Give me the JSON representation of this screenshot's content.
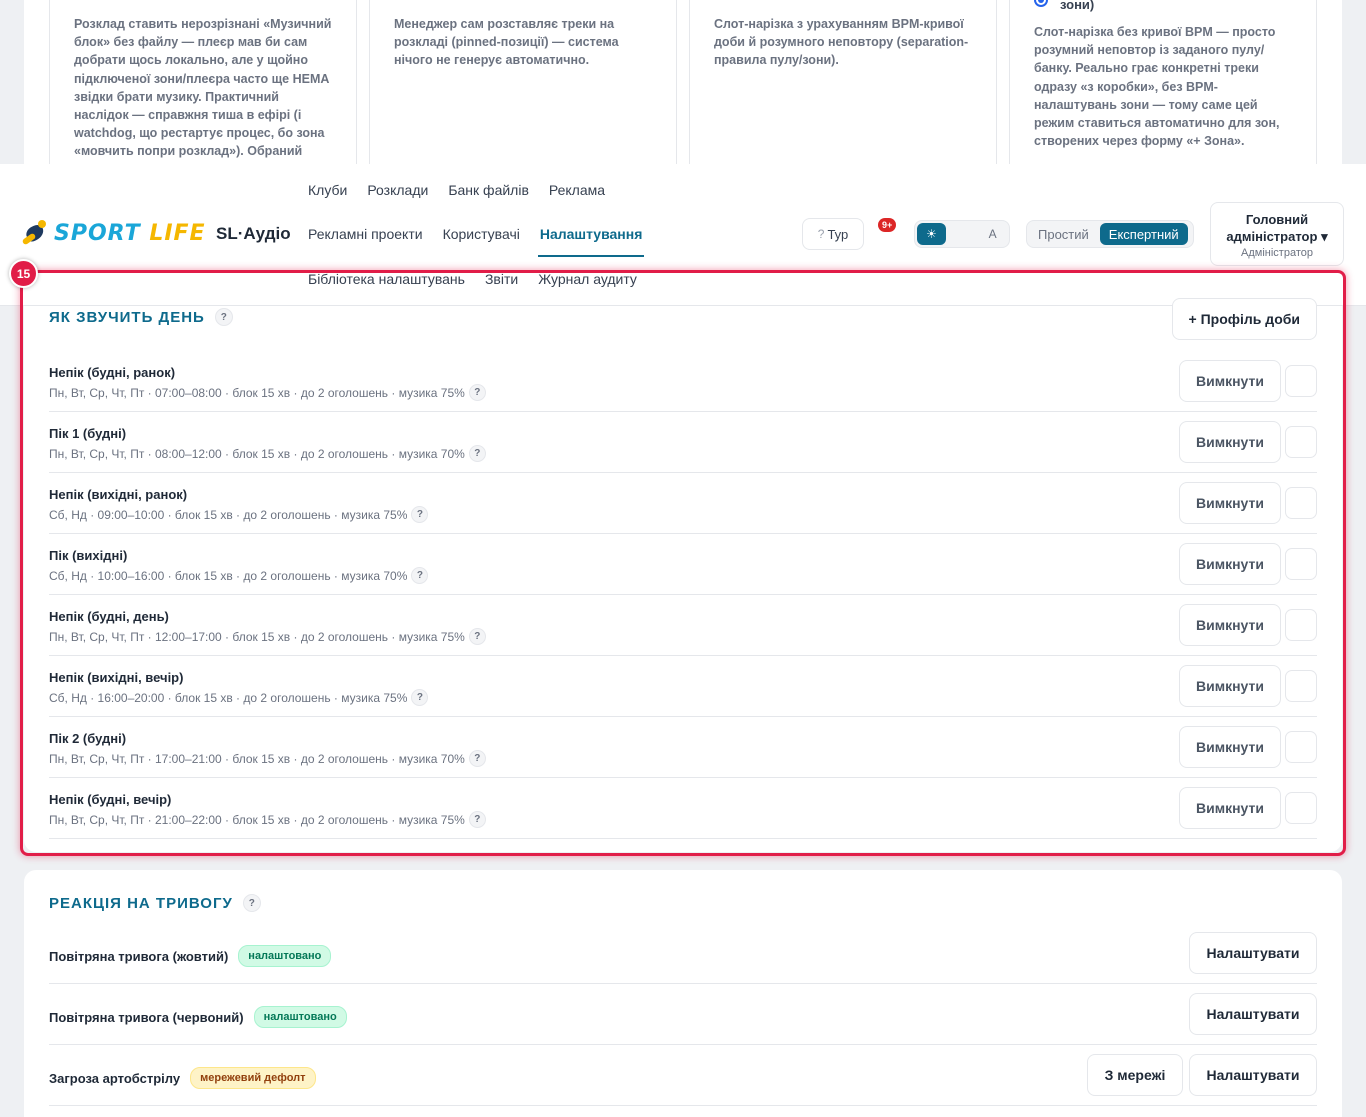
{
  "modes": [
    {
      "desc": "Розклад ставить нерозрізнані «Музичний блок» без файлу — плеєр мав би сам добрати щось локально, але у щойно підключеної зони/плеєра часто ще НЕМА звідки брати музику. Практичний наслідок — справжня тиша в ефірі (і watchdog, що рестартує процес, бо зона «мовчить попри розклад»). Обраний такий режим"
    },
    {
      "desc": "Менеджер сам розставляє треки на розкладі (pinned-позиції) — система нічого не генерує автоматично."
    },
    {
      "desc": "Слот-нарізка з урахуванням BPM-кривої доби й розумного неповтору (separation-правила пулу/зони)."
    },
    {
      "radio_label": "зони)",
      "desc": "Слот-нарізка без кривої BPM — просто розумний неповтор із заданого пулу/банку. Реально грає конкретні треки одразу «з коробки», без BPM-налаштувань зони — тому саме цей режим ставиться автоматично для зон, створених через форму «+ Зона»."
    }
  ],
  "header": {
    "logo_sport": "SPORT",
    "logo_life": "LIFE",
    "app_name": "SL·Аудіо",
    "nav_row1": [
      "Клуби",
      "Розклади",
      "Банк файлів",
      "Реклама"
    ],
    "nav_row2": [
      "Рекламні проекти",
      "Користувачі",
      "Налаштування"
    ],
    "nav_active": "Налаштування",
    "nav_row3": [
      "Бібліотека налаштувань",
      "Звіти",
      "Журнал аудиту"
    ],
    "search_icon": "",
    "tour_icon": "?",
    "tour_label": "Тур",
    "bell_icon": "",
    "bell_badge": "9+",
    "theme_options": [
      "☀",
      "",
      "A"
    ],
    "mode_simple": "Простий",
    "mode_expert": "Експертний",
    "user_name": "Головний адміністратор",
    "user_caret": "▾",
    "user_role": "Адміністратор"
  },
  "highlight_badge": "15",
  "day_section": {
    "title": "ЯК ЗВУЧИТЬ ДЕНЬ",
    "help": "?",
    "add_button": "+ Профіль доби",
    "off_label": "Вимкнути",
    "icon_glyph": "",
    "rows": [
      {
        "name": "Непік (будні, ранок)",
        "meta": "Пн, Вт, Ср, Чт, Пт · 07:00–08:00 · блок 15 хв · до 2 оголошень · музика 75%"
      },
      {
        "name": "Пік 1 (будні)",
        "meta": "Пн, Вт, Ср, Чт, Пт · 08:00–12:00 · блок 15 хв · до 2 оголошень · музика 70%"
      },
      {
        "name": "Непік (вихідні, ранок)",
        "meta": "Сб, Нд · 09:00–10:00 · блок 15 хв · до 2 оголошень · музика 75%"
      },
      {
        "name": "Пік (вихідні)",
        "meta": "Сб, Нд · 10:00–16:00 · блок 15 хв · до 2 оголошень · музика 70%"
      },
      {
        "name": "Непік (будні, день)",
        "meta": "Пн, Вт, Ср, Чт, Пт · 12:00–17:00 · блок 15 хв · до 2 оголошень · музика 75%"
      },
      {
        "name": "Непік (вихідні, вечір)",
        "meta": "Сб, Нд · 16:00–20:00 · блок 15 хв · до 2 оголошень · музика 75%"
      },
      {
        "name": "Пік 2 (будні)",
        "meta": "Пн, Вт, Ср, Чт, Пт · 17:00–21:00 · блок 15 хв · до 2 оголошень · музика 70%"
      },
      {
        "name": "Непік (будні, вечір)",
        "meta": "Пн, Вт, Ср, Чт, Пт · 21:00–22:00 · блок 15 хв · до 2 оголошень · музика 75%"
      }
    ]
  },
  "alarm_section": {
    "title": "РЕАКЦІЯ НА ТРИВОГУ",
    "help": "?",
    "configure_label": "Налаштувати",
    "network_label": "З мережі",
    "rows": [
      {
        "name": "Повітряна тривога (жовтий)",
        "badge": "налаштовано",
        "badge_type": "green"
      },
      {
        "name": "Повітряна тривога (червоний)",
        "badge": "налаштовано",
        "badge_type": "green"
      },
      {
        "name": "Загроза артобстрілу",
        "badge": "мережевий дефолт",
        "badge_type": "amber"
      }
    ]
  }
}
